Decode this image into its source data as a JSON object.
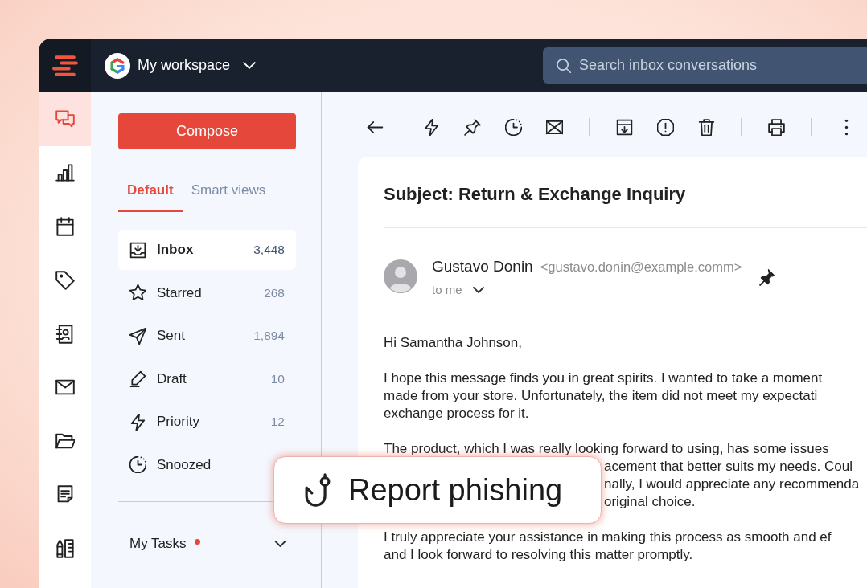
{
  "top_bar": {
    "workspace": {
      "name": "My workspace"
    },
    "search": {
      "placeholder": "Search inbox conversations"
    }
  },
  "rail": {
    "items": [
      {
        "selected": true
      },
      {
        "selected": false
      },
      {
        "selected": false
      },
      {
        "selected": false
      },
      {
        "selected": false
      },
      {
        "selected": false
      },
      {
        "selected": false
      },
      {
        "selected": false
      },
      {
        "selected": false
      }
    ]
  },
  "sidebar": {
    "compose_button": {
      "label": "Compose"
    },
    "tabs": [
      {
        "label": "Default",
        "selected": true
      },
      {
        "label": "Smart views",
        "selected": false
      }
    ],
    "folders": [
      {
        "label": "Inbox",
        "count": "3,448",
        "selected": true
      },
      {
        "label": "Starred",
        "count": "268",
        "selected": false
      },
      {
        "label": "Sent",
        "count": "1,894",
        "selected": false
      },
      {
        "label": "Draft",
        "count": "10",
        "selected": false
      },
      {
        "label": "Priority",
        "count": "12",
        "selected": false
      },
      {
        "label": "Snoozed",
        "selected": false
      }
    ],
    "sections": [
      {
        "label": "My Tasks",
        "unread": true
      }
    ]
  },
  "email": {
    "subject": "Subject: Return & Exchange Inquiry",
    "sender": {
      "name": "Gustavo Donin",
      "email": "<gustavo.donin@example.comm>"
    },
    "recipient": "to me",
    "pinned": true,
    "greeting": "Hi Samantha Johnson,",
    "paragraphs": [
      {
        "lines": [
          "I hope this message finds you in great spirits. I wanted to take a moment",
          "made from your store. Unfortunately, the item did not meet my expectati",
          "exchange process for it."
        ]
      },
      {
        "lines": [
          "The product, which I was really looking forward to using, has some issues"
        ],
        "partly_covered_lines": [
          "acement that better suits my needs. Coul",
          "nally, I would appreciate any recommenda",
          "original choice."
        ]
      },
      {
        "lines": [
          "I truly appreciate your assistance in making this process as smooth and ef",
          "and I look forward to resolving this matter promptly."
        ]
      }
    ]
  },
  "report_phishing_popup": {
    "label": "Report phishing"
  }
}
